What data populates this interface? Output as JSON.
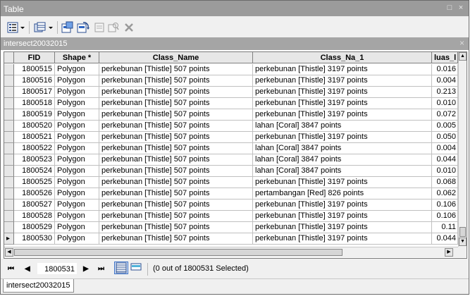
{
  "window": {
    "title": "Table",
    "restore_glyph": "□",
    "close_glyph": "×"
  },
  "table_title": {
    "name": "intersect20032015",
    "close_glyph": "×"
  },
  "columns": [
    "FID",
    "Shape *",
    "Class_Name",
    "Class_Na_1",
    "luas_l"
  ],
  "rows": [
    {
      "fid": "1800515",
      "shape": "Polygon",
      "class_name": "perkebunan [Thistle] 507 points",
      "class_na_1": "perkebunan [Thistle] 3197 points",
      "luas": "0.016"
    },
    {
      "fid": "1800516",
      "shape": "Polygon",
      "class_name": "perkebunan [Thistle] 507 points",
      "class_na_1": "perkebunan [Thistle] 3197 points",
      "luas": "0.004"
    },
    {
      "fid": "1800517",
      "shape": "Polygon",
      "class_name": "perkebunan [Thistle] 507 points",
      "class_na_1": "perkebunan [Thistle] 3197 points",
      "luas": "0.213"
    },
    {
      "fid": "1800518",
      "shape": "Polygon",
      "class_name": "perkebunan [Thistle] 507 points",
      "class_na_1": "perkebunan [Thistle] 3197 points",
      "luas": "0.010"
    },
    {
      "fid": "1800519",
      "shape": "Polygon",
      "class_name": "perkebunan [Thistle] 507 points",
      "class_na_1": "perkebunan [Thistle] 3197 points",
      "luas": "0.072"
    },
    {
      "fid": "1800520",
      "shape": "Polygon",
      "class_name": "perkebunan [Thistle] 507 points",
      "class_na_1": "lahan [Coral] 3847 points",
      "luas": "0.005"
    },
    {
      "fid": "1800521",
      "shape": "Polygon",
      "class_name": "perkebunan [Thistle] 507 points",
      "class_na_1": "perkebunan [Thistle] 3197 points",
      "luas": "0.050"
    },
    {
      "fid": "1800522",
      "shape": "Polygon",
      "class_name": "perkebunan [Thistle] 507 points",
      "class_na_1": "lahan [Coral] 3847 points",
      "luas": "0.004"
    },
    {
      "fid": "1800523",
      "shape": "Polygon",
      "class_name": "perkebunan [Thistle] 507 points",
      "class_na_1": "lahan [Coral] 3847 points",
      "luas": "0.044"
    },
    {
      "fid": "1800524",
      "shape": "Polygon",
      "class_name": "perkebunan [Thistle] 507 points",
      "class_na_1": "lahan [Coral] 3847 points",
      "luas": "0.010"
    },
    {
      "fid": "1800525",
      "shape": "Polygon",
      "class_name": "perkebunan [Thistle] 507 points",
      "class_na_1": "perkebunan [Thistle] 3197 points",
      "luas": "0.068"
    },
    {
      "fid": "1800526",
      "shape": "Polygon",
      "class_name": "perkebunan [Thistle] 507 points",
      "class_na_1": "pertambangan [Red] 826 points",
      "luas": "0.062"
    },
    {
      "fid": "1800527",
      "shape": "Polygon",
      "class_name": "perkebunan [Thistle] 507 points",
      "class_na_1": "perkebunan [Thistle] 3197 points",
      "luas": "0.106"
    },
    {
      "fid": "1800528",
      "shape": "Polygon",
      "class_name": "perkebunan [Thistle] 507 points",
      "class_na_1": "perkebunan [Thistle] 3197 points",
      "luas": "0.106"
    },
    {
      "fid": "1800529",
      "shape": "Polygon",
      "class_name": "perkebunan [Thistle] 507 points",
      "class_na_1": "perkebunan [Thistle] 3197 points",
      "luas": "0.11"
    },
    {
      "fid": "1800530",
      "shape": "Polygon",
      "class_name": "perkebunan [Thistle] 507 points",
      "class_na_1": "perkebunan [Thistle] 3197 points",
      "luas": "0.044",
      "current": true
    }
  ],
  "nav": {
    "first": "⏮",
    "prev": "◀",
    "record": "1800531",
    "next": "▶",
    "last": "⏭"
  },
  "status": "(0 out of 1800531 Selected)",
  "tab": "intersect20032015",
  "icons": [
    "table-options-icon",
    "related-tables-icon",
    "select-by-attributes-icon",
    "switch-selection-icon",
    "clear-selection-icon",
    "zoom-to-selected-icon",
    "delete-selected-icon",
    "show-all-records-icon",
    "show-selected-records-icon"
  ],
  "colors": {
    "titlebar": "#9b9b9b",
    "tablebar": "#a5a5a5",
    "header_bg": "#e7e7e7"
  }
}
